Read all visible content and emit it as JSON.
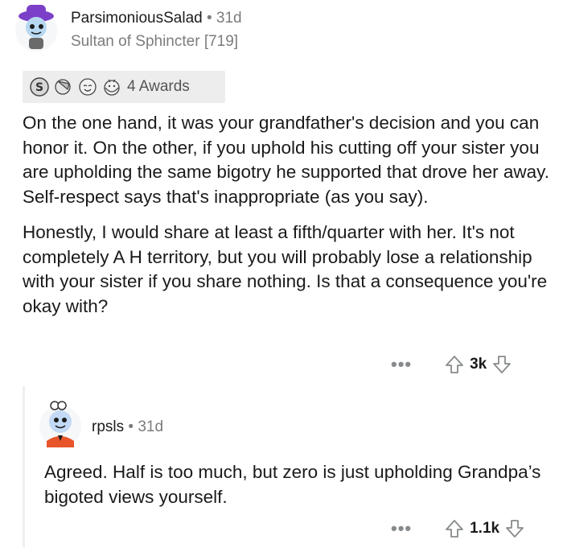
{
  "comment": {
    "username": "ParsimoniousSalad",
    "separator": "•",
    "age": "31d",
    "flair": "Sultan of Sphincter [719]",
    "awards": {
      "icons": [
        "silver-award-icon",
        "facepalm-award-icon",
        "wholesome-award-icon",
        "hugz-award-icon"
      ],
      "label": "4 Awards"
    },
    "paragraphs": [
      "On the one hand, it was your grandfather's decision and you can honor it. On the other, if you uphold his cutting off your sister you are upholding the same bigotry he supported that drove her away. Self-respect says that's inappropriate (as you say).",
      "Honestly, I would share at least a fifth/quarter with her. It's not completely A H territory, but you will probably lose a relationship with your sister if you share nothing. Is that a consequence you're okay with?"
    ],
    "more_label": "•••",
    "score": "3k"
  },
  "reply": {
    "username": "rpsls",
    "separator": "•",
    "age": "31d",
    "text": "Agreed. Half is too much, but zero is just upholding Grandpa’s bigoted views yourself.",
    "more_label": "•••",
    "score": "1.1k"
  },
  "colors": {
    "avatar1_hat": "#7b3fc8",
    "avatar1_face": "#b8d8f2",
    "avatar2_face": "#c3d9f5",
    "avatar2_shirt": "#e8552a",
    "meta_gray": "#7c7c7c"
  }
}
